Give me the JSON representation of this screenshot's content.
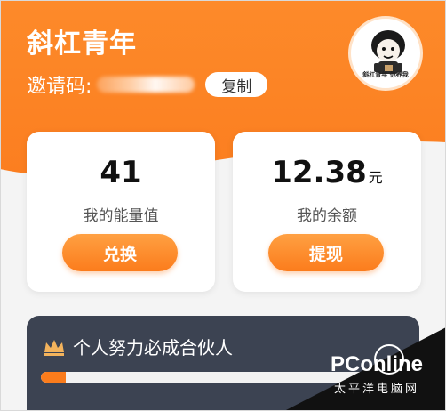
{
  "profile": {
    "nickname": "斜杠青年",
    "invite_label": "邀请码:",
    "copy_label": "复制",
    "avatar_caption": "斜杠青年 你养我"
  },
  "cards": {
    "energy": {
      "value": "41",
      "label": "我的能量值",
      "button": "兑换"
    },
    "balance": {
      "value": "12.38",
      "unit": "元",
      "label": "我的余额",
      "button": "提现"
    }
  },
  "partner": {
    "title": "个人努力必成合伙人",
    "progress": 0.07
  },
  "watermark": {
    "logo": "PConline",
    "subtitle": "太平洋电脑网"
  },
  "colors": {
    "accent": "#fb7c1c",
    "partner_bg": "#3c4352",
    "crown": "#f3b35c"
  },
  "icons": {
    "crown": "crown-icon",
    "avatar": "cartoon-avatar"
  }
}
